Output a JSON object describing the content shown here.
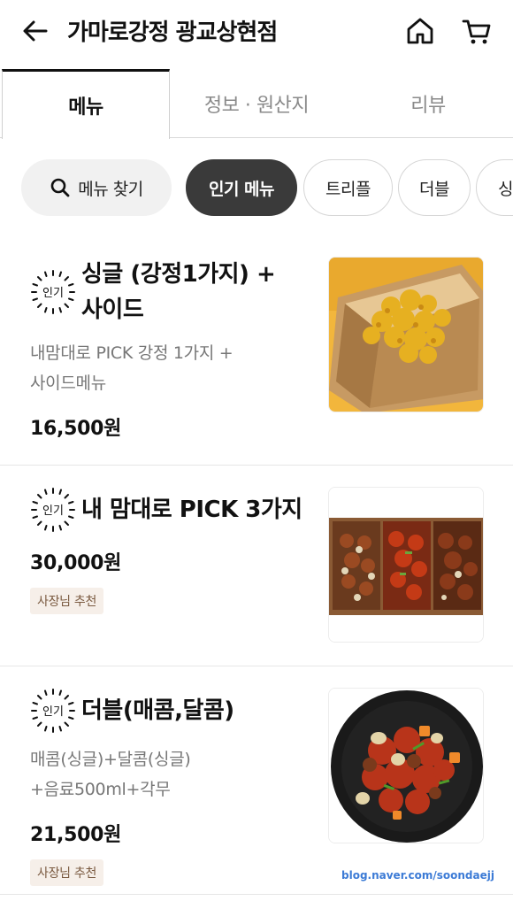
{
  "header": {
    "back_icon": "arrow-left-icon",
    "title": "가마로강정 광교상현점",
    "home_icon": "home-icon",
    "cart_icon": "cart-icon"
  },
  "tabs": [
    {
      "label": "메뉴",
      "active": true
    },
    {
      "label": "정보 · 원산지",
      "active": false
    },
    {
      "label": "리뷰",
      "active": false
    }
  ],
  "chips": {
    "search_label": "메뉴 찾기",
    "search_icon": "search-icon",
    "items": [
      {
        "label": "인기 메뉴",
        "active": true
      },
      {
        "label": "트리플",
        "active": false
      },
      {
        "label": "더블",
        "active": false
      },
      {
        "label": "싱",
        "active": false
      }
    ]
  },
  "badge_text": "인기",
  "menu_items": [
    {
      "name_line1": "싱글 (강정1가지) +",
      "name_line2": "사이드",
      "desc_line1": "내맘대로 PICK 강정 1가지 +",
      "desc_line2": "사이드메뉴",
      "price": "16,500원",
      "tag": "",
      "photo": "gangjeong-box-photo"
    },
    {
      "name_line1": "내 맘대로 PICK 3가지",
      "name_line2": "",
      "desc_line1": "",
      "desc_line2": "",
      "price": "30,000원",
      "tag": "사장님 추천",
      "photo": "three-gangjeong-tray-photo"
    },
    {
      "name_line1": "더블(매콤,달콤)",
      "name_line2": "",
      "desc_line1": "매콤(싱글)+달콤(싱글)",
      "desc_line2": "+음료500ml+각무",
      "price": "21,500원",
      "tag": "사장님 추천",
      "photo": "spicy-chicken-plate-photo"
    }
  ],
  "watermark": "blog.naver.com/soondaejj",
  "colors": {
    "active_chip": "#3a3a3a",
    "tag_bg": "#f6efe9",
    "tag_text": "#7a5a40",
    "divider": "#e6e6e6"
  }
}
